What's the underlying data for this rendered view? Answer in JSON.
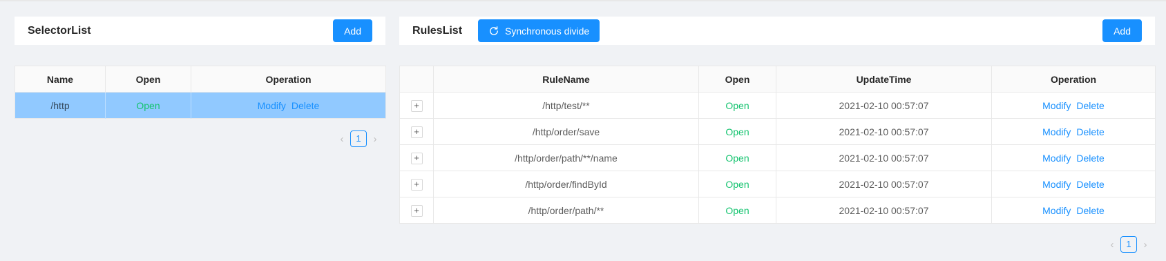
{
  "selector_panel": {
    "title": "SelectorList",
    "add_label": "Add",
    "columns": [
      "Name",
      "Open",
      "Operation"
    ],
    "rows": [
      {
        "name": "/http",
        "open": "Open",
        "modify": "Modify",
        "delete": "Delete"
      }
    ],
    "pagination": {
      "current": "1"
    }
  },
  "rules_panel": {
    "title": "RulesList",
    "sync_label": "Synchronous divide",
    "add_label": "Add",
    "columns": [
      "",
      "RuleName",
      "Open",
      "UpdateTime",
      "Operation"
    ],
    "rows": [
      {
        "expand": "+",
        "name": "/http/test/**",
        "open": "Open",
        "time": "2021-02-10 00:57:07",
        "modify": "Modify",
        "delete": "Delete"
      },
      {
        "expand": "+",
        "name": "/http/order/save",
        "open": "Open",
        "time": "2021-02-10 00:57:07",
        "modify": "Modify",
        "delete": "Delete"
      },
      {
        "expand": "+",
        "name": "/http/order/path/**/name",
        "open": "Open",
        "time": "2021-02-10 00:57:07",
        "modify": "Modify",
        "delete": "Delete"
      },
      {
        "expand": "+",
        "name": "/http/order/findById",
        "open": "Open",
        "time": "2021-02-10 00:57:07",
        "modify": "Modify",
        "delete": "Delete"
      },
      {
        "expand": "+",
        "name": "/http/order/path/**",
        "open": "Open",
        "time": "2021-02-10 00:57:07",
        "modify": "Modify",
        "delete": "Delete"
      }
    ],
    "pagination": {
      "current": "1"
    }
  },
  "icons": {
    "sync": "sync-icon",
    "prev": "chevron-left-icon",
    "next": "chevron-right-icon"
  },
  "colors": {
    "primary": "#1890ff",
    "open_status": "#14c36f",
    "selected_row": "#91c9ff",
    "background": "#f0f2f5"
  }
}
